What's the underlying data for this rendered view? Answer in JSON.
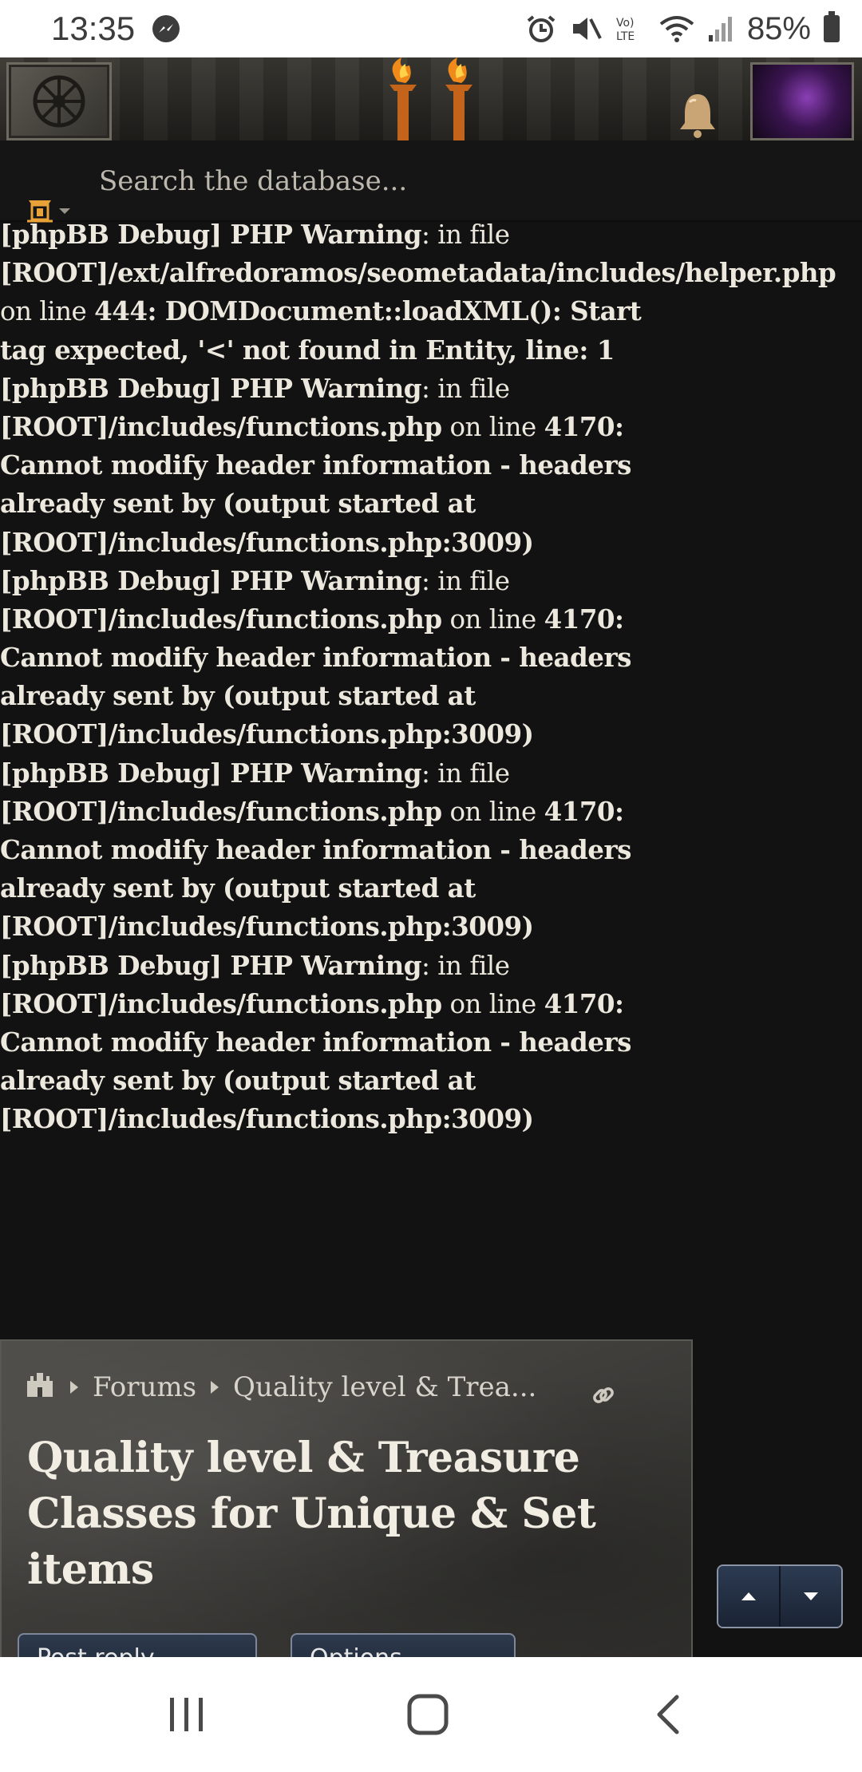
{
  "status_bar": {
    "time": "13:35",
    "battery": "85%",
    "icons": [
      "messenger-icon",
      "alarm-icon",
      "mute-icon",
      "volte-icon",
      "wifi-icon",
      "signal-icon",
      "battery-icon"
    ],
    "volte_label": "Vo) LTE"
  },
  "header": {
    "icons": [
      "menu-tile-icon",
      "site-logo",
      "bell-icon",
      "user-avatar"
    ]
  },
  "search": {
    "placeholder": "Search the database..."
  },
  "debug_lines": [
    {
      "bold": "[phpBB Debug] PHP Warning",
      "normal": ": in file"
    },
    {
      "bold": "[ROOT]/ext/alfredoramos/seometadata/includes/helper.php",
      "normal": ""
    },
    {
      "bold": "",
      "normal": "on line ",
      "bold2": "444: DOMDocument::loadXML(): Start"
    },
    {
      "bold": "tag expected, '<' not found in Entity, line: 1",
      "normal": ""
    },
    {
      "bold": "[phpBB Debug] PHP Warning",
      "normal": ": in file"
    },
    {
      "bold": "[ROOT]/includes/functions.php",
      "normal": " on line ",
      "bold2": "4170:"
    },
    {
      "bold": "Cannot modify header information - headers",
      "normal": ""
    },
    {
      "bold": "already sent by (output started at",
      "normal": ""
    },
    {
      "bold": "[ROOT]/includes/functions.php:3009)",
      "normal": ""
    },
    {
      "bold": "[phpBB Debug] PHP Warning",
      "normal": ": in file"
    },
    {
      "bold": "[ROOT]/includes/functions.php",
      "normal": " on line ",
      "bold2": "4170:"
    },
    {
      "bold": "Cannot modify header information - headers",
      "normal": ""
    },
    {
      "bold": "already sent by (output started at",
      "normal": ""
    },
    {
      "bold": "[ROOT]/includes/functions.php:3009)",
      "normal": ""
    },
    {
      "bold": "[phpBB Debug] PHP Warning",
      "normal": ": in file"
    },
    {
      "bold": "[ROOT]/includes/functions.php",
      "normal": " on line ",
      "bold2": "4170:"
    },
    {
      "bold": "Cannot modify header information - headers",
      "normal": ""
    },
    {
      "bold": "already sent by (output started at",
      "normal": ""
    },
    {
      "bold": "[ROOT]/includes/functions.php:3009)",
      "normal": ""
    },
    {
      "bold": "[phpBB Debug] PHP Warning",
      "normal": ": in file"
    },
    {
      "bold": "[ROOT]/includes/functions.php",
      "normal": " on line ",
      "bold2": "4170:"
    },
    {
      "bold": "Cannot modify header information - headers",
      "normal": ""
    },
    {
      "bold": "already sent by (output started at",
      "normal": ""
    },
    {
      "bold": "[ROOT]/includes/functions.php:3009)",
      "normal": ""
    }
  ],
  "breadcrumb": {
    "items": [
      "Forums",
      "Quality level & Trea..."
    ]
  },
  "topic": {
    "title": "Quality level & Treasure Classes for Unique & Set items"
  },
  "actions": {
    "post_reply": "Post reply",
    "options": "Options"
  },
  "colors": {
    "page_bg": "#121212",
    "text": "#ece8de",
    "panel": "#3c3b38",
    "button": "#1e2736"
  }
}
